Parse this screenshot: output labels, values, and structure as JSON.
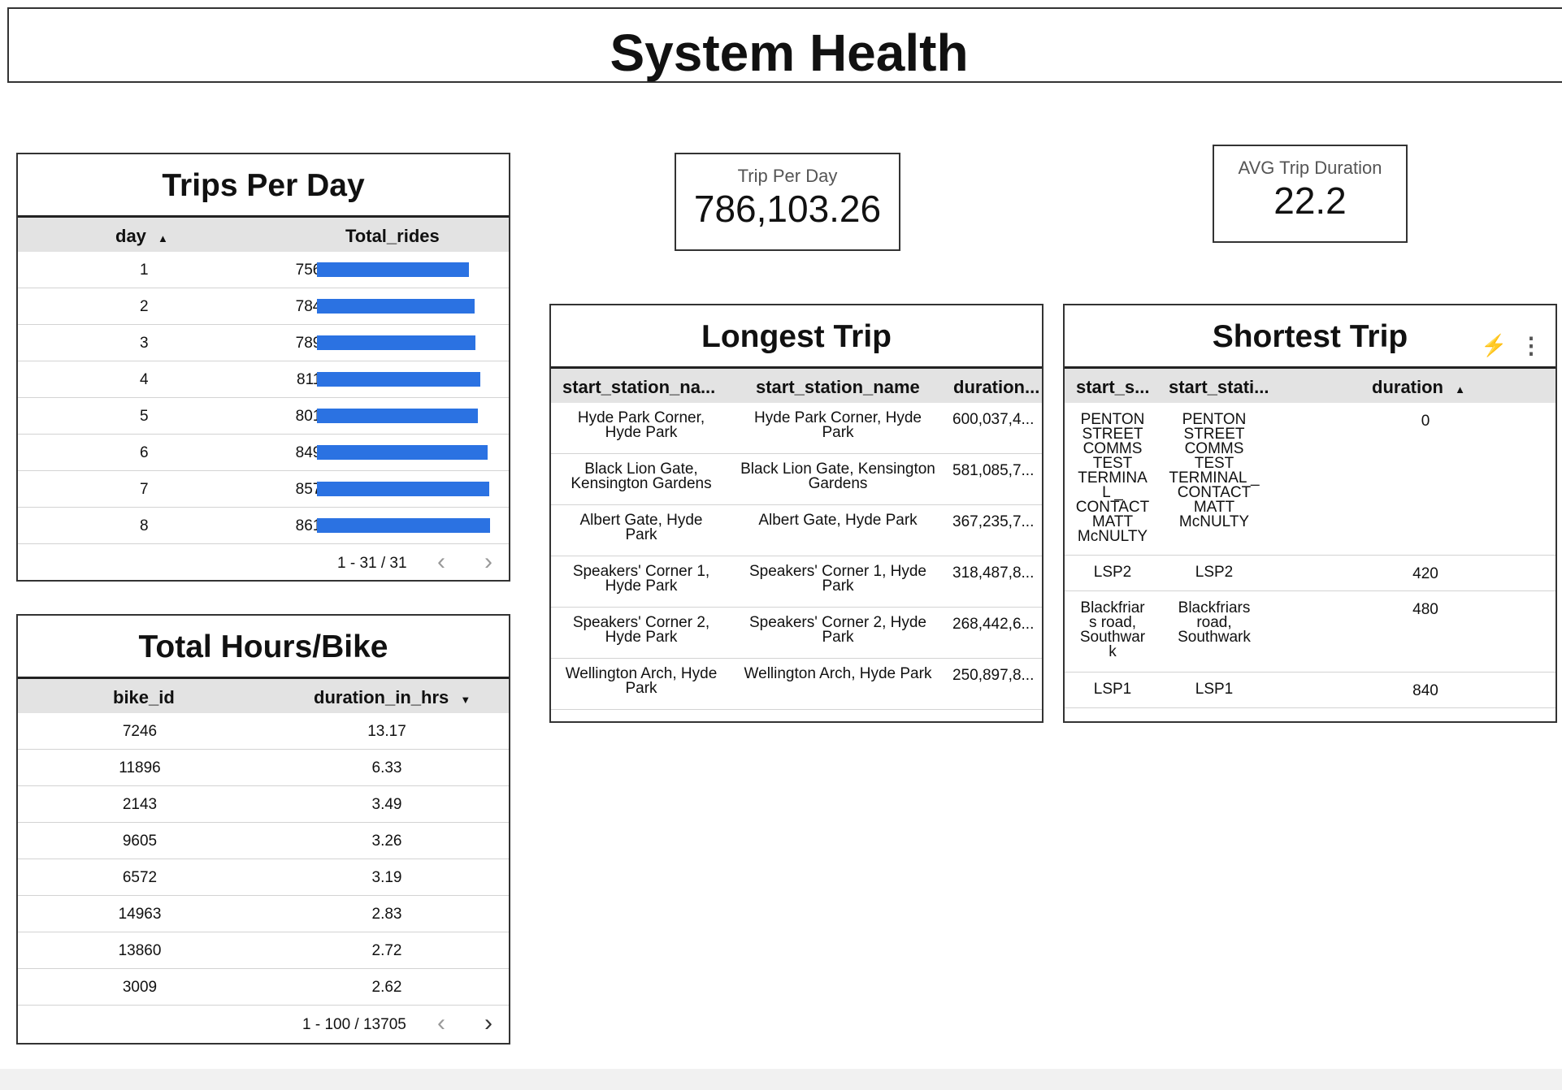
{
  "page_title": "System Health",
  "trips_per_day": {
    "title": "Trips Per Day",
    "col_day": "day",
    "col_total": "Total_rides",
    "sort_icon": "sort-ascending-icon",
    "rows": [
      {
        "day": "1",
        "label": "756K",
        "value": 756
      },
      {
        "day": "2",
        "label": "784K",
        "value": 784
      },
      {
        "day": "3",
        "label": "789K",
        "value": 789
      },
      {
        "day": "4",
        "label": "811K",
        "value": 811
      },
      {
        "day": "5",
        "label": "801K",
        "value": 801
      },
      {
        "day": "6",
        "label": "849K",
        "value": 849
      },
      {
        "day": "7",
        "label": "857K",
        "value": 857
      },
      {
        "day": "8",
        "label": "861K",
        "value": 861
      }
    ],
    "pager": "1 - 31 / 31",
    "bar_color": "#2b72e2"
  },
  "hours_per_bike": {
    "title": "Total Hours/Bike",
    "col_bike": "bike_id",
    "col_duration": "duration_in_hrs",
    "sort_icon": "sort-descending-icon",
    "rows": [
      {
        "bike": "7246",
        "hrs": "13.17"
      },
      {
        "bike": "11896",
        "hrs": "6.33"
      },
      {
        "bike": "2143",
        "hrs": "3.49"
      },
      {
        "bike": "9605",
        "hrs": "3.26"
      },
      {
        "bike": "6572",
        "hrs": "3.19"
      },
      {
        "bike": "14963",
        "hrs": "2.83"
      },
      {
        "bike": "13860",
        "hrs": "2.72"
      },
      {
        "bike": "3009",
        "hrs": "2.62"
      }
    ],
    "pager": "1 - 100 / 13705"
  },
  "trip_per_day_card": {
    "label": "Trip Per Day",
    "value": "786,103.26"
  },
  "avg_duration_card": {
    "label": "AVG Trip Duration",
    "value": "22.2"
  },
  "longest_trip": {
    "title": "Longest Trip",
    "col1": "start_station_na...",
    "col2": "start_station_name",
    "col3": "duration...",
    "rows": [
      {
        "a1": "Hyde Park Corner,",
        "a2": "Hyde Park",
        "b1": "Hyde Park Corner, Hyde",
        "b2": "Park",
        "d": "600,037,4..."
      },
      {
        "a1": "Black Lion Gate,",
        "a2": "Kensington Gardens",
        "b1": "Black Lion Gate, Kensington",
        "b2": "Gardens",
        "d": "581,085,7..."
      },
      {
        "a1": "Albert Gate, Hyde",
        "a2": "Park",
        "b1": "Albert Gate, Hyde Park",
        "b2": "",
        "d": "367,235,7..."
      },
      {
        "a1": "Speakers' Corner 1,",
        "a2": "Hyde Park",
        "b1": "Speakers' Corner 1, Hyde",
        "b2": "Park",
        "d": "318,487,8..."
      },
      {
        "a1": "Speakers' Corner 2,",
        "a2": "Hyde Park",
        "b1": "Speakers' Corner 2, Hyde",
        "b2": "Park",
        "d": "268,442,6..."
      },
      {
        "a1": "Wellington Arch, Hyde",
        "a2": "Park",
        "b1": "Wellington Arch, Hyde Park",
        "b2": "",
        "d": "250,897,8..."
      }
    ]
  },
  "shortest_trip": {
    "title": "Shortest Trip",
    "col1": "start_s...",
    "col2": "start_stati...",
    "col3": "duration",
    "icons": [
      "bolt-icon",
      "more-vert-icon"
    ],
    "rows": [
      {
        "a": [
          "PENTON",
          "STREET",
          "COMMS",
          "TEST",
          "TERMINA",
          "L _",
          "CONTACT",
          "MATT",
          "McNULTY"
        ],
        "b": [
          "PENTON",
          "STREET",
          "COMMS",
          "TEST",
          "TERMINAL _",
          "CONTACT",
          "MATT",
          "McNULTY"
        ],
        "d": "0"
      },
      {
        "a": [
          "LSP2"
        ],
        "b": [
          "LSP2"
        ],
        "d": "420"
      },
      {
        "a": [
          "Blackfriar",
          "s road,",
          "Southwar",
          "k"
        ],
        "b": [
          "Blackfriars",
          "road,",
          "Southwark"
        ],
        "d": "480"
      },
      {
        "a": [
          "LSP1"
        ],
        "b": [
          "LSP1"
        ],
        "d": "840"
      }
    ]
  }
}
